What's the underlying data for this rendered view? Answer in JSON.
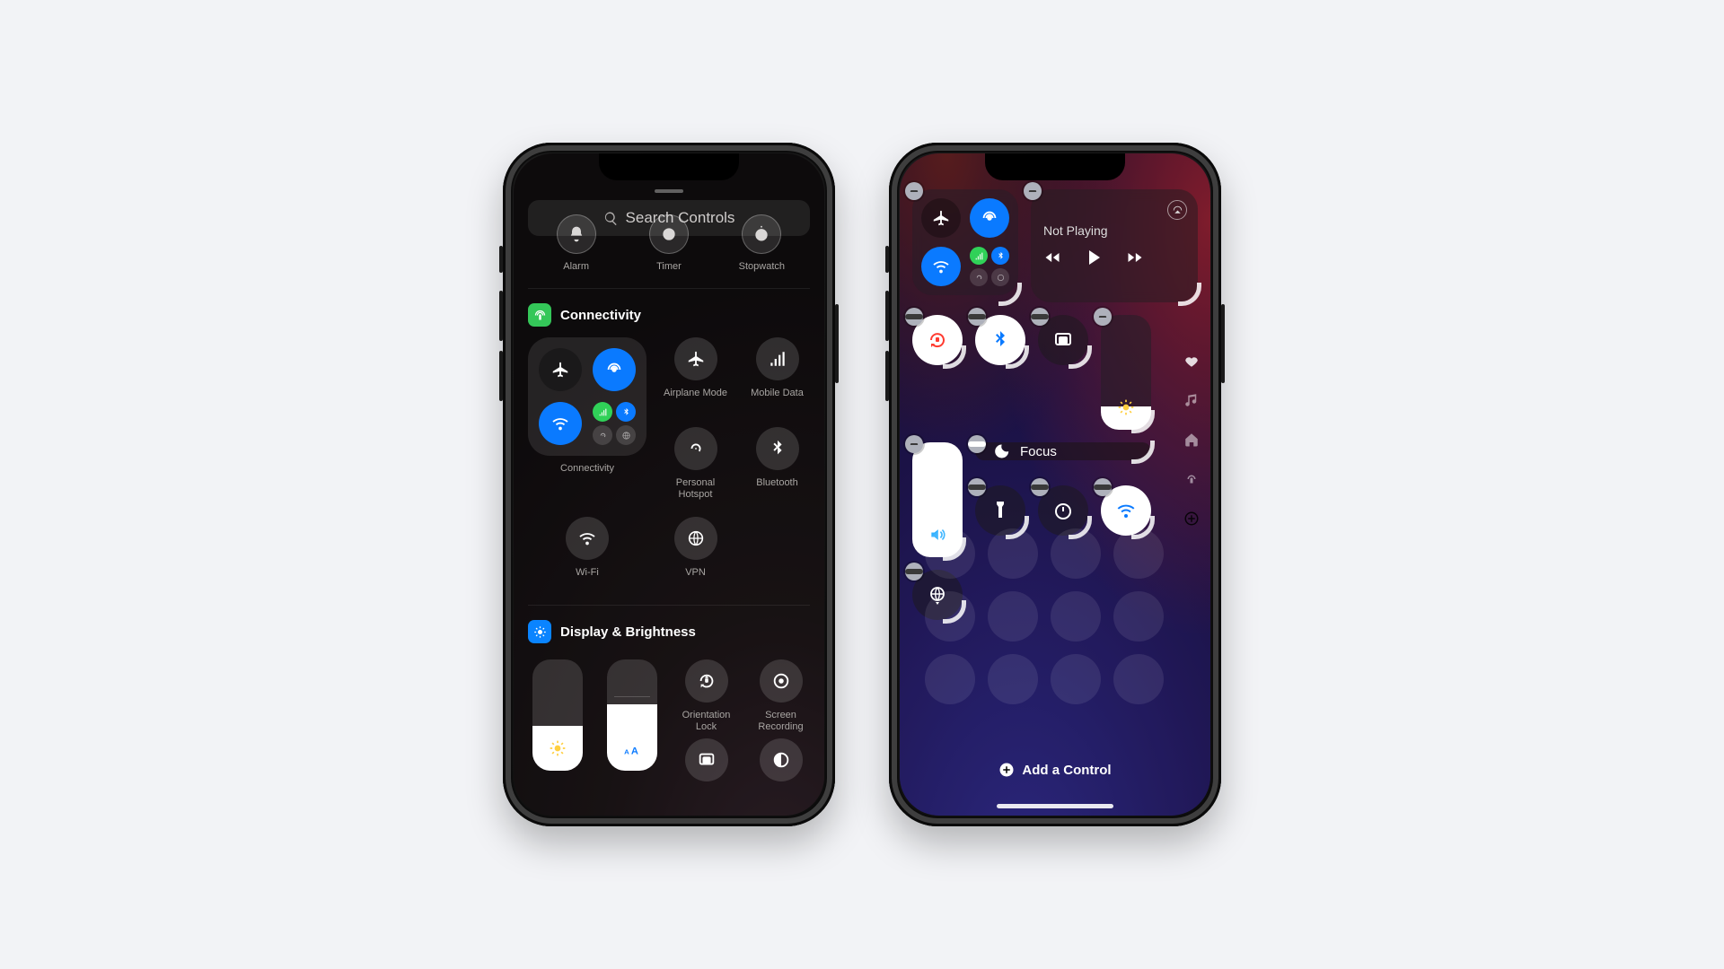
{
  "phoneA": {
    "search_placeholder": "Search Controls",
    "quick": [
      {
        "label": "Alarm"
      },
      {
        "label": "Timer"
      },
      {
        "label": "Stopwatch"
      }
    ],
    "sections": {
      "connectivity": {
        "title": "Connectivity",
        "tiles": {
          "connectivity": "Connectivity",
          "airplane": "Airplane Mode",
          "mobile": "Mobile Data",
          "hotspot": "Personal Hotspot",
          "bluetooth": "Bluetooth",
          "wifi": "Wi-Fi",
          "vpn": "VPN"
        }
      },
      "display": {
        "title": "Display & Brightness",
        "labels": {
          "orientation": "Orientation Lock",
          "screenrec": "Screen Recording"
        },
        "brightness_pct": 40,
        "textsize_pct": 60
      }
    }
  },
  "phoneB": {
    "now_playing": "Not Playing",
    "focus_label": "Focus",
    "add_control": "Add a Control",
    "brightness_pct": 20,
    "volume_pct": 100,
    "ghost_slots": 12
  }
}
